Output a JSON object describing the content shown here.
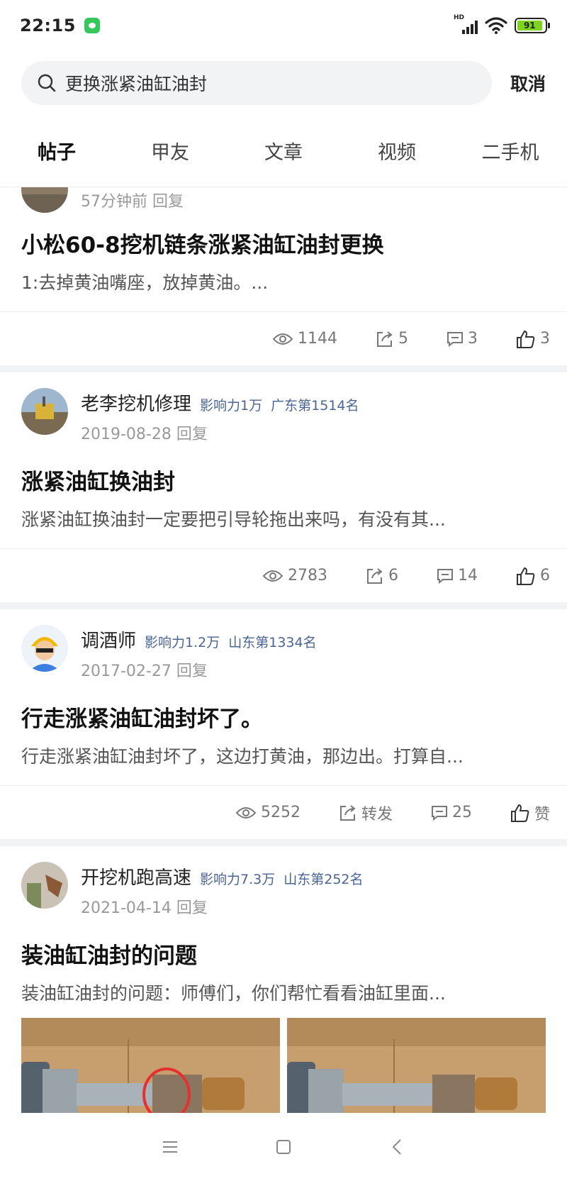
{
  "status_bar": {
    "time": "22:15",
    "network_label": "HD",
    "battery_level": "91",
    "battery_fraction": 0.91
  },
  "search": {
    "query": "更换涨紧油缸油封",
    "cancel_label": "取消"
  },
  "tabs": [
    {
      "label": "帖子",
      "active": true
    },
    {
      "label": "甲友",
      "active": false
    },
    {
      "label": "文章",
      "active": false
    },
    {
      "label": "视频",
      "active": false
    },
    {
      "label": "二手机",
      "active": false
    }
  ],
  "posts": [
    {
      "time": "57分钟前",
      "reply": "回复",
      "title": "小松60-8挖机链条涨紧油缸油封更换",
      "excerpt": "1:去掉黄油嘴座，放掉黄油。...",
      "views": "1144",
      "shares": "5",
      "comments": "3",
      "likes": "3"
    },
    {
      "author": "老李挖机修理",
      "influence": "影响力1万",
      "rank": "广东第1514名",
      "date": "2019-08-28",
      "reply": "回复",
      "title": "涨紧油缸换油封",
      "excerpt": "涨紧油缸换油封一定要把引导轮拖出来吗，有没有其...",
      "views": "2783",
      "shares": "6",
      "comments": "14",
      "likes": "6"
    },
    {
      "author": "调酒师",
      "influence": "影响力1.2万",
      "rank": "山东第1334名",
      "date": "2017-02-27",
      "reply": "回复",
      "title": "行走涨紧油缸油封坏了。",
      "excerpt": "行走涨紧油缸油封坏了，这边打黄油，那边出。打算自...",
      "views": "5252",
      "shares": "转发",
      "comments": "25",
      "likes": "赞"
    },
    {
      "author": "开挖机跑高速",
      "influence": "影响力7.3万",
      "rank": "山东第252名",
      "date": "2021-04-14",
      "reply": "回复",
      "title": "装油缸油封的问题",
      "excerpt": "装油缸油封的问题：师傅们，你们帮忙看看油缸里面..."
    }
  ],
  "colors": {
    "accent": "#3b6be8",
    "badge": "#4a6494",
    "battery": "#7ed321"
  }
}
